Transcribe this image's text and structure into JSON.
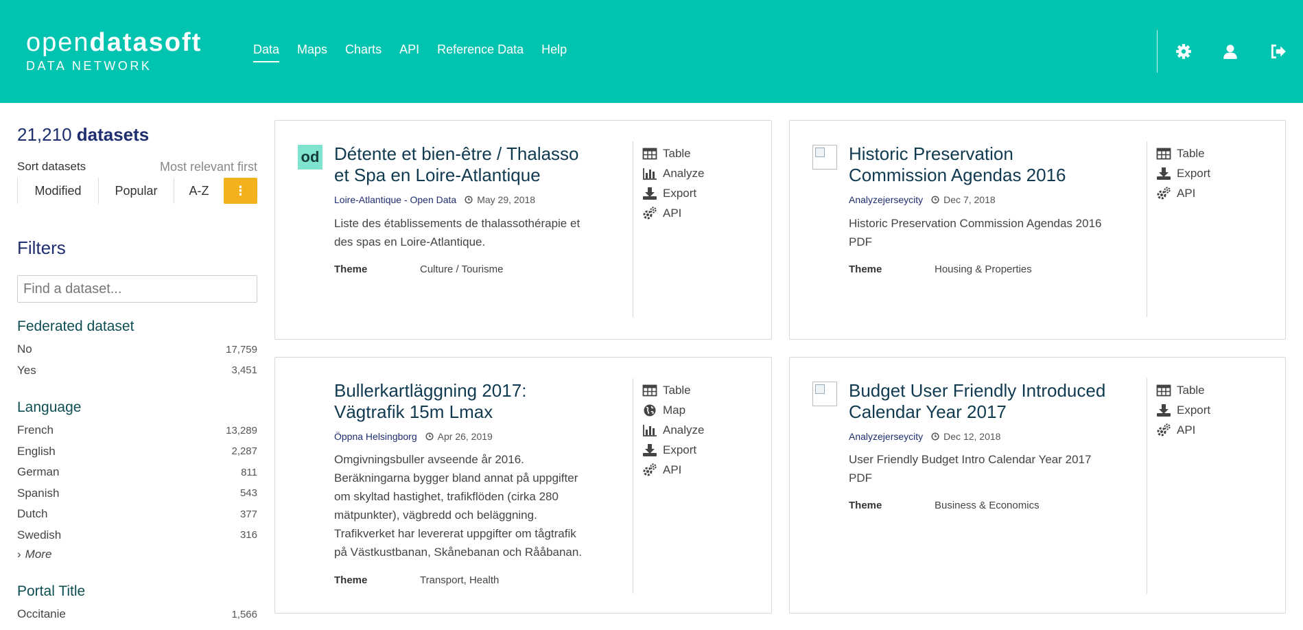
{
  "header": {
    "logo_light": "open",
    "logo_bold": "datasoft",
    "logo_sub": "DATA NETWORK",
    "nav": [
      "Data",
      "Maps",
      "Charts",
      "API",
      "Reference Data",
      "Help"
    ],
    "icons": [
      "gear-icon",
      "user-icon",
      "sign-out-icon"
    ]
  },
  "sidebar": {
    "count_number": "21,210",
    "count_word": "datasets",
    "sort_label": "Sort datasets",
    "sort_value": "Most relevant first",
    "sort_buttons": [
      "Modified",
      "Popular",
      "A-Z"
    ],
    "more_glyph": "⋮",
    "filters_title": "Filters",
    "search_placeholder": "Find a dataset...",
    "groups": [
      {
        "title": "Federated dataset",
        "items": [
          {
            "label": "No",
            "count": "17,759"
          },
          {
            "label": "Yes",
            "count": "3,451"
          }
        ]
      },
      {
        "title": "Language",
        "items": [
          {
            "label": "French",
            "count": "13,289"
          },
          {
            "label": "English",
            "count": "2,287"
          },
          {
            "label": "German",
            "count": "811"
          },
          {
            "label": "Spanish",
            "count": "543"
          },
          {
            "label": "Dutch",
            "count": "377"
          },
          {
            "label": "Swedish",
            "count": "316"
          }
        ],
        "more": "More"
      },
      {
        "title": "Portal Title",
        "items": [
          {
            "label": "Occitanie",
            "count": "1,566"
          }
        ]
      }
    ]
  },
  "cards": [
    {
      "thumb_text": "od",
      "title_lines": [
        "Détente et bien-être / Thalasso",
        "et Spa en Loire-Atlantique"
      ],
      "publisher": "Loire-Atlantique - Open Data",
      "date": "May 29, 2018",
      "desc_lines": [
        "Liste des établissements de thalassothérapie et",
        "des spas en Loire-Atlantique."
      ],
      "theme_label": "Theme",
      "theme_value": "Culture / Tourisme",
      "actions": [
        "Table",
        "Analyze",
        "Export",
        "API"
      ]
    },
    {
      "thumb_text": "",
      "title_lines": [
        "Historic Preservation",
        "Commission Agendas 2016"
      ],
      "publisher": "Analyzejerseycity",
      "date": "Dec 7, 2018",
      "desc_lines": [
        "Historic Preservation Commission Agendas 2016",
        "PDF"
      ],
      "theme_label": "Theme",
      "theme_value": "Housing & Properties",
      "actions": [
        "Table",
        "Export",
        "API"
      ]
    },
    {
      "thumb_text": "",
      "title_lines": [
        "Bullerkartläggning 2017:",
        "Vägtrafik 15m Lmax"
      ],
      "publisher": "Öppna Helsingborg",
      "date": "Apr 26, 2019",
      "desc_lines": [
        "Omgivningsbuller avseende år 2016.",
        "Beräkningarna bygger bland annat på uppgifter",
        "om skyltad hastighet, trafikflöden (cirka 280",
        "mätpunkter), vägbredd och beläggning.",
        "Trafikverket har levererat uppgifter om tågtrafik",
        "på Västkustbanan, Skånebanan och Rååbanan."
      ],
      "theme_label": "Theme",
      "theme_value": "Transport, Health",
      "actions": [
        "Table",
        "Map",
        "Analyze",
        "Export",
        "API"
      ]
    },
    {
      "thumb_text": "",
      "title_lines": [
        "Budget User Friendly Introduced",
        "Calendar Year 2017"
      ],
      "publisher": "Analyzejerseycity",
      "date": "Dec 12, 2018",
      "desc_lines": [
        "User Friendly Budget Intro Calendar Year 2017",
        "PDF"
      ],
      "theme_label": "Theme",
      "theme_value": "Business & Economics",
      "actions": [
        "Table",
        "Export",
        "API"
      ]
    }
  ]
}
